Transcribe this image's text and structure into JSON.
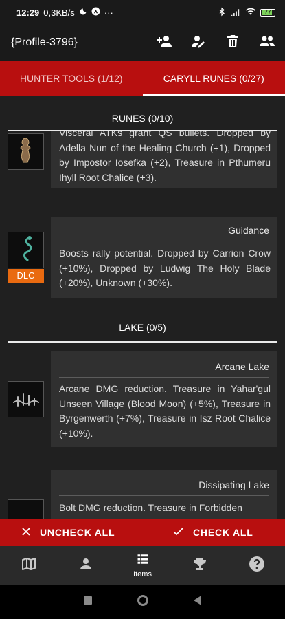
{
  "status_bar": {
    "time": "12:29",
    "speed": "0,3KB/s",
    "battery": "77"
  },
  "app_bar": {
    "title": "{Profile-3796}"
  },
  "tabs": [
    {
      "label": "HUNTER TOOLS (1/12)",
      "active": false
    },
    {
      "label": "CARYLL RUNES (0/27)",
      "active": true
    }
  ],
  "sections": {
    "runes": {
      "header": "RUNES (0/10)"
    },
    "lake": {
      "header": "LAKE (0/5)"
    }
  },
  "cards": {
    "partial": {
      "desc": "Visceral ATKs grant QS bullets. Dropped by Adella Nun of the Healing Church (+1), Dropped by Impostor Iosefka (+2), Treasure in Pthumeru Ihyll Root Chalice (+3)."
    },
    "guidance": {
      "title": "Guidance",
      "badge": "DLC",
      "desc": "Boosts rally potential. Dropped by Carrion Crow (+10%), Dropped by Ludwig The Holy Blade (+20%), Unknown (+30%)."
    },
    "arcane_lake": {
      "title": "Arcane Lake",
      "desc": "Arcane DMG reduction. Treasure in Yahar'gul Unseen Village (Blood Moon) (+5%), Treasure in Byrgenwerth (+7%), Treasure in Isz Root Chalice (+10%)."
    },
    "dissipating_lake": {
      "title": "Dissipating Lake",
      "desc": "Bolt DMG reduction. Treasure in Forbidden"
    }
  },
  "actions": {
    "uncheck_all": "UNCHECK ALL",
    "check_all": "CHECK ALL"
  },
  "bottom_nav": {
    "items_label": "Items"
  },
  "colors": {
    "accent_red": "#b80f0f",
    "dlc_orange": "#e96a10",
    "card_bg": "#303030",
    "page_bg": "#202020"
  }
}
